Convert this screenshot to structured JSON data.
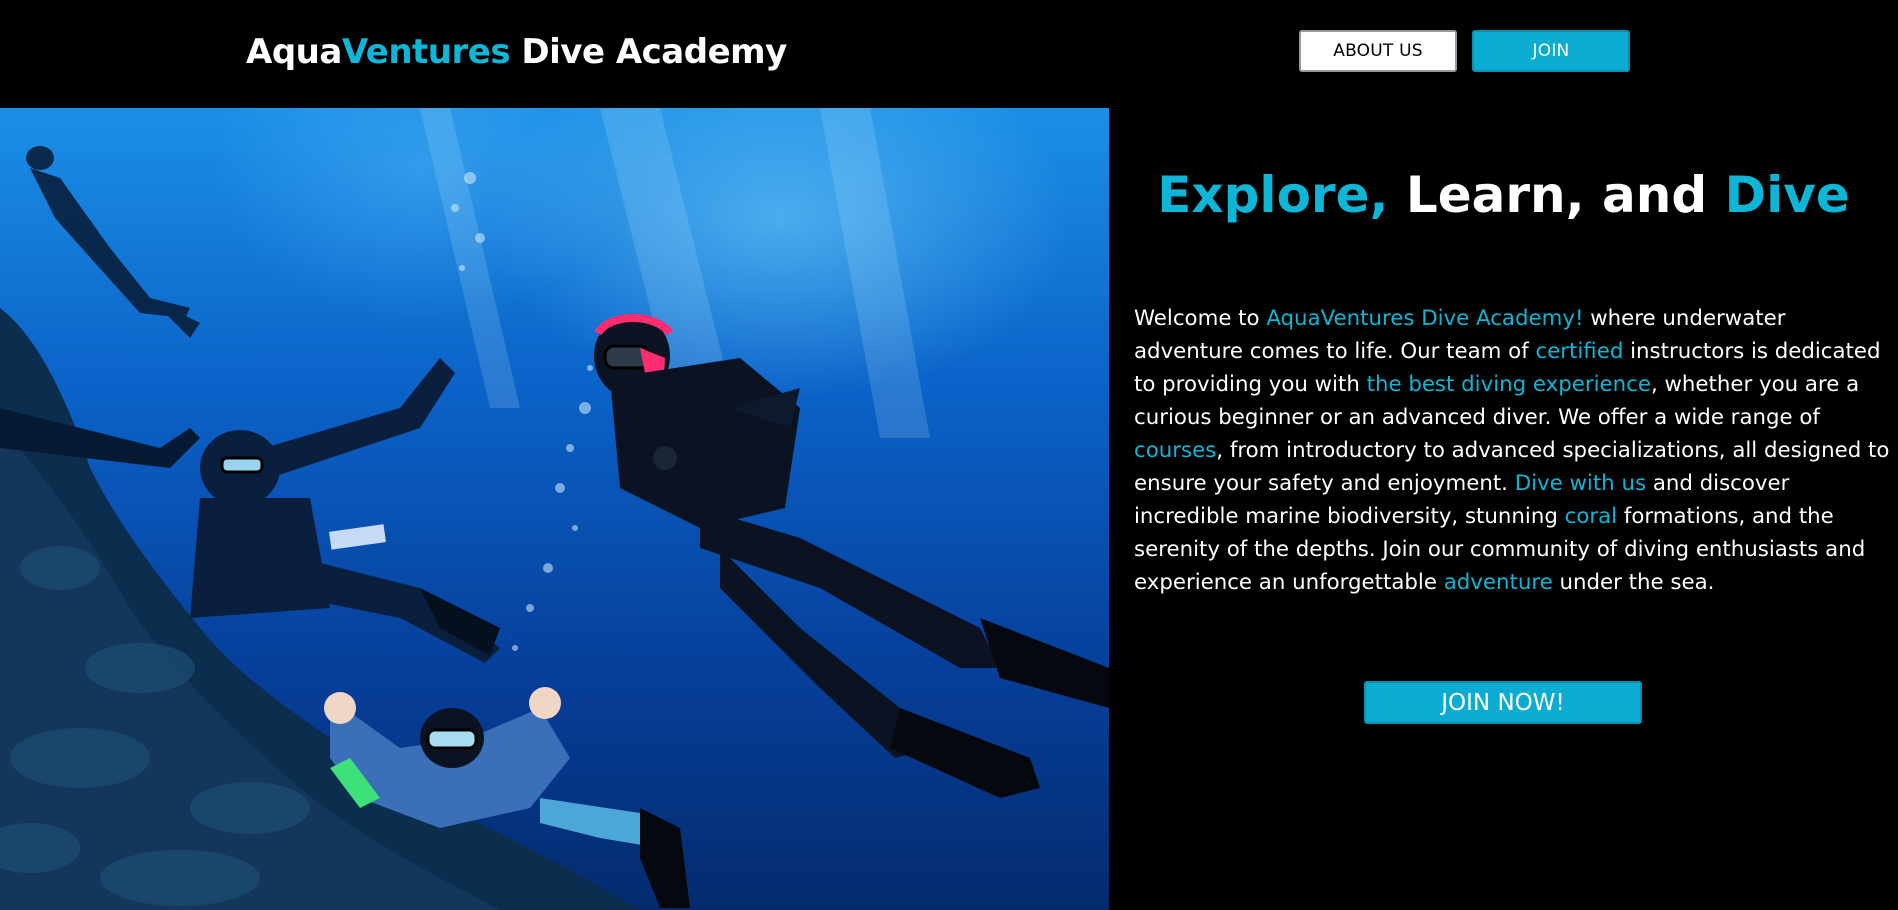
{
  "header": {
    "brand": {
      "part1": "Aqua",
      "part2": "Ventures",
      "part3": " Dive Academy"
    },
    "about_label": "ABOUT US",
    "join_label": "JOIN"
  },
  "hero": {
    "headline": {
      "part1": "Explore,",
      "part2": " Learn, and ",
      "part3": "Dive"
    },
    "paragraph": [
      {
        "text": "Welcome to ",
        "hl": false
      },
      {
        "text": "AquaVentures Dive Academy!",
        "hl": true
      },
      {
        "text": " where underwater adventure comes to life. Our team of ",
        "hl": false
      },
      {
        "text": "certified",
        "hl": true
      },
      {
        "text": " instructors is dedicated to providing you with ",
        "hl": false
      },
      {
        "text": "the best diving experience",
        "hl": true
      },
      {
        "text": ", whether you are a curious beginner or an advanced diver. We offer a wide range of ",
        "hl": false
      },
      {
        "text": "courses",
        "hl": true
      },
      {
        "text": ", from introductory to advanced specializations, all designed to ensure your safety and enjoyment. ",
        "hl": false
      },
      {
        "text": "Dive with us",
        "hl": true
      },
      {
        "text": " and discover incredible marine biodiversity, stunning ",
        "hl": false
      },
      {
        "text": "coral",
        "hl": true
      },
      {
        "text": " formations, and the serenity of the depths. Join our community of diving enthusiasts and experience an unforgettable ",
        "hl": false
      },
      {
        "text": "adventure",
        "hl": true
      },
      {
        "text": " under the sea.",
        "hl": false
      }
    ],
    "cta_label": "JOIN NOW!"
  },
  "colors": {
    "accent": "#0db5d6",
    "button": "#0aacd1",
    "background": "#000000",
    "text": "#ffffff"
  }
}
